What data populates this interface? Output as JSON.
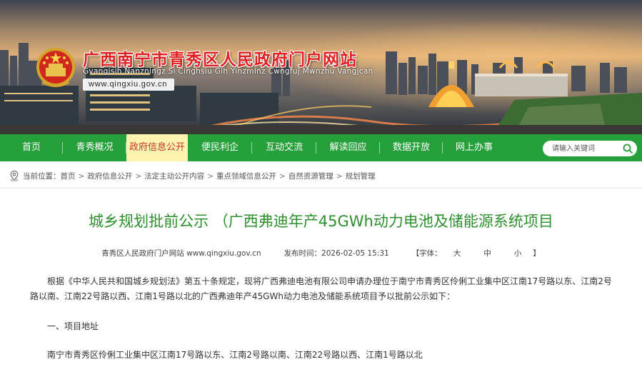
{
  "header": {
    "title": "广西南宁市青秀区人民政府门户网站",
    "pinyin": "Gvangjsih Nanzningz Si Cinghsiu Gih Yinzminz Cwngfuj Mwnzhu Vangjcan",
    "url": "www.qingxiu.gov.cn"
  },
  "nav": {
    "items": [
      {
        "label": "首页"
      },
      {
        "label": "青秀概况"
      },
      {
        "label": "政府信息公开"
      },
      {
        "label": "便民利企"
      },
      {
        "label": "互动交流"
      },
      {
        "label": "解读回应"
      },
      {
        "label": "数据开放"
      },
      {
        "label": "网上办事"
      }
    ],
    "active_index": 2
  },
  "search": {
    "placeholder": "请输入关键词"
  },
  "breadcrumb": {
    "prefix": "当前位置：",
    "items": [
      "首页",
      "政府信息公开",
      "法定主动公开内容",
      "重点领域信息公开",
      "自然资源管理",
      "规划管理"
    ],
    "separator": ">"
  },
  "article": {
    "title": "城乡规划批前公示 （广西弗迪年产45GWh动力电池及储能源系统项目",
    "source": "青秀区人民政府门户网站 www.qingxiu.gov.cn",
    "published": "发布时间：2026-02-05 15:31",
    "font_size_label": "【字体：",
    "font_size_options": [
      "大",
      "中",
      "小"
    ],
    "font_size_close": "】",
    "paragraphs": [
      "根据《中华人民共和国城乡规划法》第五十条规定，现将广西弗迪电池有限公司申请办理位于南宁市青秀区伶俐工业集中区江南17号路以东、江南2号路以南、江南22号路以西、江南1号路以北的广西弗迪年产45GWh动力电池及储能系统项目予以批前公示如下：",
      "一、项目地址",
      "南宁市青秀区伶俐工业集中区江南17号路以东、江南2号路以南、江南22号路以西、江南1号路以北"
    ]
  },
  "colors": {
    "nav_green": "#26a03a",
    "title_red": "#e02020",
    "article_title_green": "#2d8f2d",
    "active_tab_bg": "#fff3b0",
    "active_tab_text": "#c2362b"
  }
}
